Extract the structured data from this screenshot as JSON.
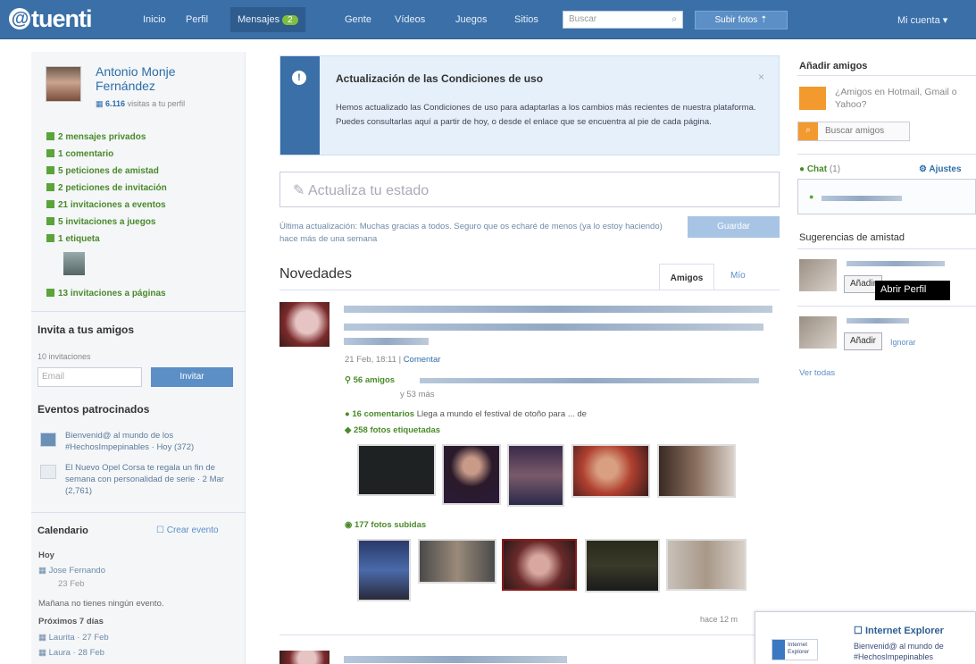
{
  "topbar": {
    "logo": "tuenti",
    "nav": [
      {
        "label": "Inicio"
      },
      {
        "label": "Perfil"
      },
      {
        "label": "Mensajes",
        "badge": "2"
      },
      {
        "label": "Gente"
      },
      {
        "label": "Vídeos"
      },
      {
        "label": "Juegos"
      },
      {
        "label": "Sitios"
      }
    ],
    "search_placeholder": "Buscar",
    "upload_label": "Subir fotos",
    "account_label": "Mi cuenta"
  },
  "profile": {
    "name": "Antonio Monje Fernández",
    "visits_count": "6.116",
    "visits_text": "visitas a tu perfil",
    "notifications": [
      "2 mensajes privados",
      "1 comentario",
      "5 peticiones de amistad",
      "2 peticiones de invitación",
      "21 invitaciones a eventos",
      "5 invitaciones a juegos",
      "1 etiqueta",
      "13 invitaciones a páginas"
    ]
  },
  "invite": {
    "title": "Invita a tus amigos",
    "remaining": "10 invitaciones",
    "email_placeholder": "Email",
    "button": "Invitar"
  },
  "events": {
    "title": "Eventos patrocinados",
    "items": [
      "Bienvenid@ al mundo de los #HechosImpepinables · Hoy (372)",
      "El Nuevo Opel Corsa te regala un fin de semana con personalidad de serie · 2 Mar (2,761)"
    ]
  },
  "calendar": {
    "title": "Calendario",
    "create": "Crear evento",
    "today_label": "Hoy",
    "today_entry": "Jose Fernando",
    "today_date": "23 Feb",
    "tomorrow": "Mañana no tienes ningún evento.",
    "next7": "Próximos 7 días",
    "next_entries": [
      "Laurita · 27 Feb",
      "Laura · 28 Feb"
    ]
  },
  "notice": {
    "title": "Actualización de las Condiciones de uso",
    "close": "×",
    "body": "Hemos actualizado las Condiciones de uso para adaptarlas a los cambios más recientes de nuestra plataforma. Puedes consultarlas aquí a partir de hoy, o desde el enlace que se encuentra al pie de cada página."
  },
  "status": {
    "placeholder": "Actualiza tu estado",
    "last_update": "Última actualización: Muchas gracias a todos. Seguro que os echaré de menos (ya lo estoy haciendo) hace más de una semana",
    "save": "Guardar"
  },
  "feed": {
    "title": "Novedades",
    "tabs": [
      "Amigos",
      "Mío"
    ],
    "date": "21 Feb, 18:11",
    "comment_link": "Comentar",
    "friends_line": "56 amigos",
    "friends_more": "y 53 más",
    "comments_line": "16 comentarios",
    "comments_text": "Llega a mundo el festival de otoño para ...",
    "comments_de": "de",
    "tagged_line": "258 fotos etiquetadas",
    "uploaded_line": "177 fotos subidas",
    "more": "hace 12 m"
  },
  "right": {
    "add_friends_title": "Añadir amigos",
    "mail_text": "¿Amigos en Hotmail, Gmail o Yahoo?",
    "search_friends": "Buscar amigos",
    "chat_label": "Chat",
    "chat_count": "(1)",
    "chat_settings": "Ajustes",
    "suggestions_title": "Sugerencias de amistad",
    "sugg_btn1": "Añadir",
    "sugg_btn2": "Añadir",
    "ignore": "Ignorar",
    "see_all": "Ver todas",
    "tooltip": "Abrir Perfil"
  },
  "ie_popup": {
    "title": "Internet Explorer",
    "logo_text": "Internet Explorer",
    "desc": "Bienvenid@ al mundo de #HechosImpepinables"
  },
  "colors": {
    "topbar": "#3a6fa8",
    "accent_green": "#4a8a2a",
    "link_blue": "#2d6ea8"
  }
}
